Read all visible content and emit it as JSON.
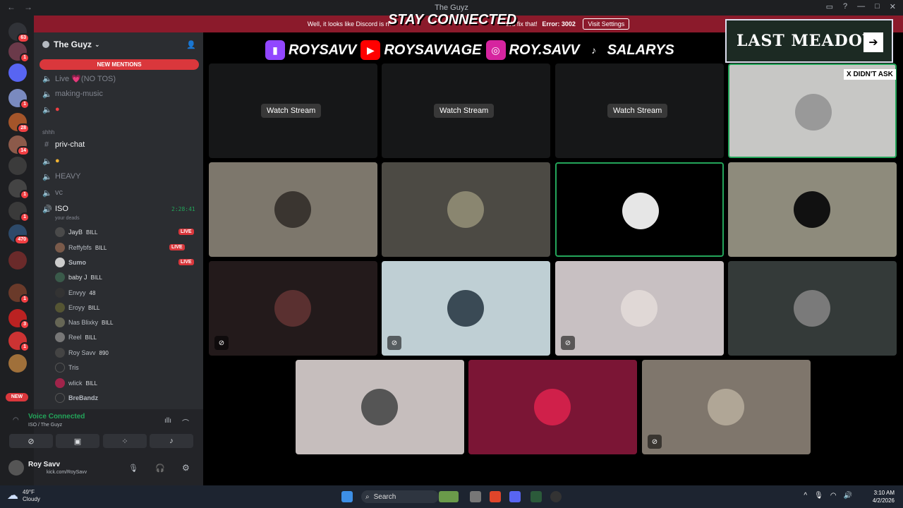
{
  "titlebar": {
    "title": "The Guyz"
  },
  "servers": {
    "badges": [
      "63",
      "1",
      "1",
      "28",
      "14",
      "1",
      "1",
      "470",
      "1",
      "3",
      "1",
      "NEW"
    ]
  },
  "guild": {
    "name": "The Guyz",
    "new_mentions": "NEW MENTIONS"
  },
  "channels": {
    "c1": "Live 💗(NO TOS)",
    "c2": "making-music",
    "c3": "",
    "cat": "shhh",
    "priv": "priv-chat",
    "heavy": "HEAVY",
    "vc": "vc",
    "iso": "ISO",
    "iso_timer": "2:28:41",
    "iso_sub": "your deads"
  },
  "members": [
    {
      "name": "JayB",
      "tag": "BILL",
      "live": "LIVE"
    },
    {
      "name": "Reffybfs",
      "tag": "BILL",
      "live": "LIVE"
    },
    {
      "name": "Sumo",
      "tag": "",
      "live": "LIVE"
    },
    {
      "name": "baby J",
      "tag": "BILL",
      "live": ""
    },
    {
      "name": "Envyy",
      "tag": "48",
      "live": ""
    },
    {
      "name": "Eroyy",
      "tag": "BILL",
      "live": ""
    },
    {
      "name": "Nas Blixky",
      "tag": "BILL",
      "live": ""
    },
    {
      "name": "Reel",
      "tag": "BILL",
      "live": ""
    },
    {
      "name": "Roy Savv",
      "tag": "890",
      "live": ""
    },
    {
      "name": "Tris",
      "tag": "",
      "live": ""
    },
    {
      "name": "wlick",
      "tag": "BILL",
      "live": ""
    },
    {
      "name": "BreBandz",
      "tag": "",
      "live": ""
    }
  ],
  "voice": {
    "status": "Voice Connected",
    "location": "ISO / The Guyz"
  },
  "user": {
    "name": "Roy Savv",
    "status": "kick.com/RoySavv"
  },
  "banner": {
    "text": "Well, it looks like Discord is n",
    "text2": "et's fix that!",
    "error": "Error: 3002",
    "button": "Visit Settings"
  },
  "overlay": {
    "stay_connected": "STAY CONNECTED",
    "twitch": "ROYSAVV",
    "youtube": "ROYSAVVAGE",
    "instagram": "ROY.SAVV",
    "tiktok": "SALARYS",
    "last_meadow": "LAST MEADOW",
    "x_didnt_ask": "X DIDN'T ASK"
  },
  "streams": {
    "watch_label": "Watch Stream"
  },
  "taskbar": {
    "temp": "49°F",
    "cond": "Cloudy",
    "search": "Search",
    "time": "3:10 AM",
    "date": "4/2/2026"
  },
  "colors": {
    "accent": "#5865f2",
    "danger": "#da373c",
    "green": "#23a55a"
  }
}
